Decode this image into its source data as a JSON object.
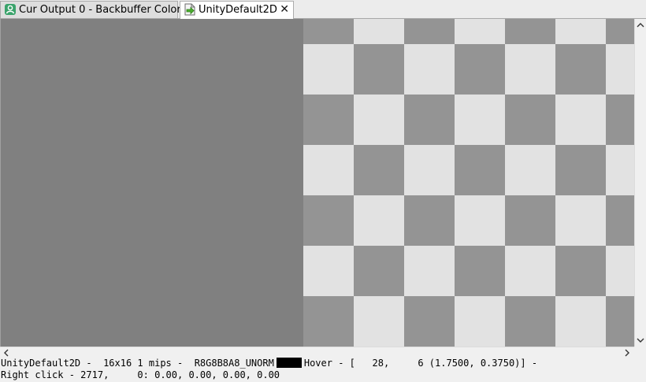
{
  "tabs": [
    {
      "label": "Cur Output 0 - Backbuffer Color",
      "icon": "output-icon",
      "active": false
    },
    {
      "label": "UnityDefault2D",
      "icon": "texture-icon",
      "active": true,
      "close": "✕"
    }
  ],
  "status": {
    "texture_name": "UnityDefault2D",
    "size": "16x16",
    "mips": "1 mips",
    "format": "R8G8B8A8_UNORM",
    "swatch_color": "#000000",
    "hover_label": "Hover",
    "hover_text": "[   28,     6 (1.7500, 0.3750)] -",
    "right_click_label": "Right click",
    "right_click_text": "2717,     0: 0.00, 0.00, 0.00, 0.00"
  },
  "colors": {
    "viewport_bg": "#808080",
    "checker_dark": "#949494",
    "checker_light": "#e2e2e2"
  }
}
